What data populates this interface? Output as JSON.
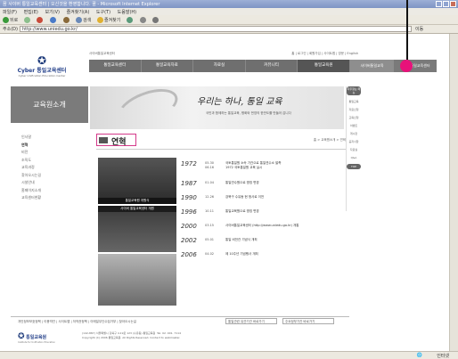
{
  "browser": {
    "title": "꿈 사이버 통일교육센터 | 오신것을 환영합니다. 꿈 - Microsoft Internet Explorer",
    "menu": [
      "파일(F)",
      "편집(E)",
      "보기(V)",
      "즐겨찾기(A)",
      "도구(T)",
      "도움말(H)"
    ],
    "toolbar": [
      "뒤로",
      "검색",
      "즐겨찾기"
    ],
    "address_label": "주소(D)",
    "address": "http://www.uniedu.go.kr/",
    "go_label": "이동",
    "status_right": "인터넷"
  },
  "site": {
    "logo_name": "Cyber 통일교육센터",
    "logo_sub": "Cyber Unification Education Center",
    "top_left": "사이버통일교육센터",
    "top_links": "홈 | 로그인 | 회원가입 | 사이트맵 | 영문 | English",
    "nav": [
      "통일교육센터",
      "통일교육자료",
      "자료실",
      "커뮤니티",
      "통일교육원"
    ],
    "nav_extra": [
      "사이버통일교육",
      "청소년통일교육센터"
    ],
    "left_banner": "교육원소개",
    "left_menu": [
      "인사말",
      "연혁",
      "비전",
      "조직도",
      "교육과정",
      "찾아오시는길",
      "시설안내",
      "홈페이지소개",
      "교육센터현황"
    ],
    "banner_calligraphy": "우리는 하나, 통일 교육",
    "banner_sub": "국민과 함께하는 통일교육, 평화와 번영의 한반도를 만들어 갑니다",
    "page_title": "연혁",
    "breadcrumb": "홈 > 교육원소개 > 연혁",
    "photo_captions": [
      "통일교육원 개원식",
      "사이버 통일교육센터 개원"
    ],
    "timeline": [
      {
        "year": "1972",
        "date": "05.30\n06.16",
        "text": "국토통일원 소속 기관으로 통일연수소 발족\n1972 국토통일원 교육 실시"
      },
      {
        "year": "1987",
        "date": "01.04",
        "text": "통일연수원으로 명칭 변경"
      },
      {
        "year": "1990",
        "date": "12.26",
        "text": "강북구 수유동 현 청사로 이전"
      },
      {
        "year": "1996",
        "date": "10.11",
        "text": "통일교육원으로 명칭 변경"
      },
      {
        "year": "2000",
        "date": "03.15",
        "text": "사이버통일교육센터 (http://www.uniedu.go.kr) 개통"
      },
      {
        "year": "2002",
        "date": "05.01",
        "text": "통일 비전관 기념식 개최"
      },
      {
        "year": "2006",
        "date": "04.02",
        "text": "제 10주년 기념행사 개최"
      }
    ],
    "right_col": [
      "자주찾는 메뉴",
      "통일교육",
      "자료신청",
      "교육신청",
      "이벤트",
      "게시판",
      "공지사항",
      "자료실",
      "Q&A",
      "TOP"
    ],
    "footer_links": "개인정보보호정책 | 이용약관 | 사이트맵 | 저작권정책 | 이메일무단수집거부 | 찾아오시는길",
    "footer_select1": "통일관련 유관기관 바로가기",
    "footer_select2": "주요정부기관 바로가기",
    "footer_logo": "통일교육원",
    "footer_logo_sub": "Institute for Unification Education",
    "footer_address": "(142-887) 서울특별시 강북구 4.19로 123 (수유동) 통일교육원  Tel. 02. 901. 7114\nCopyright (C) 2006 통일교육원. All Rights Reserved. Contact to webmaster."
  }
}
